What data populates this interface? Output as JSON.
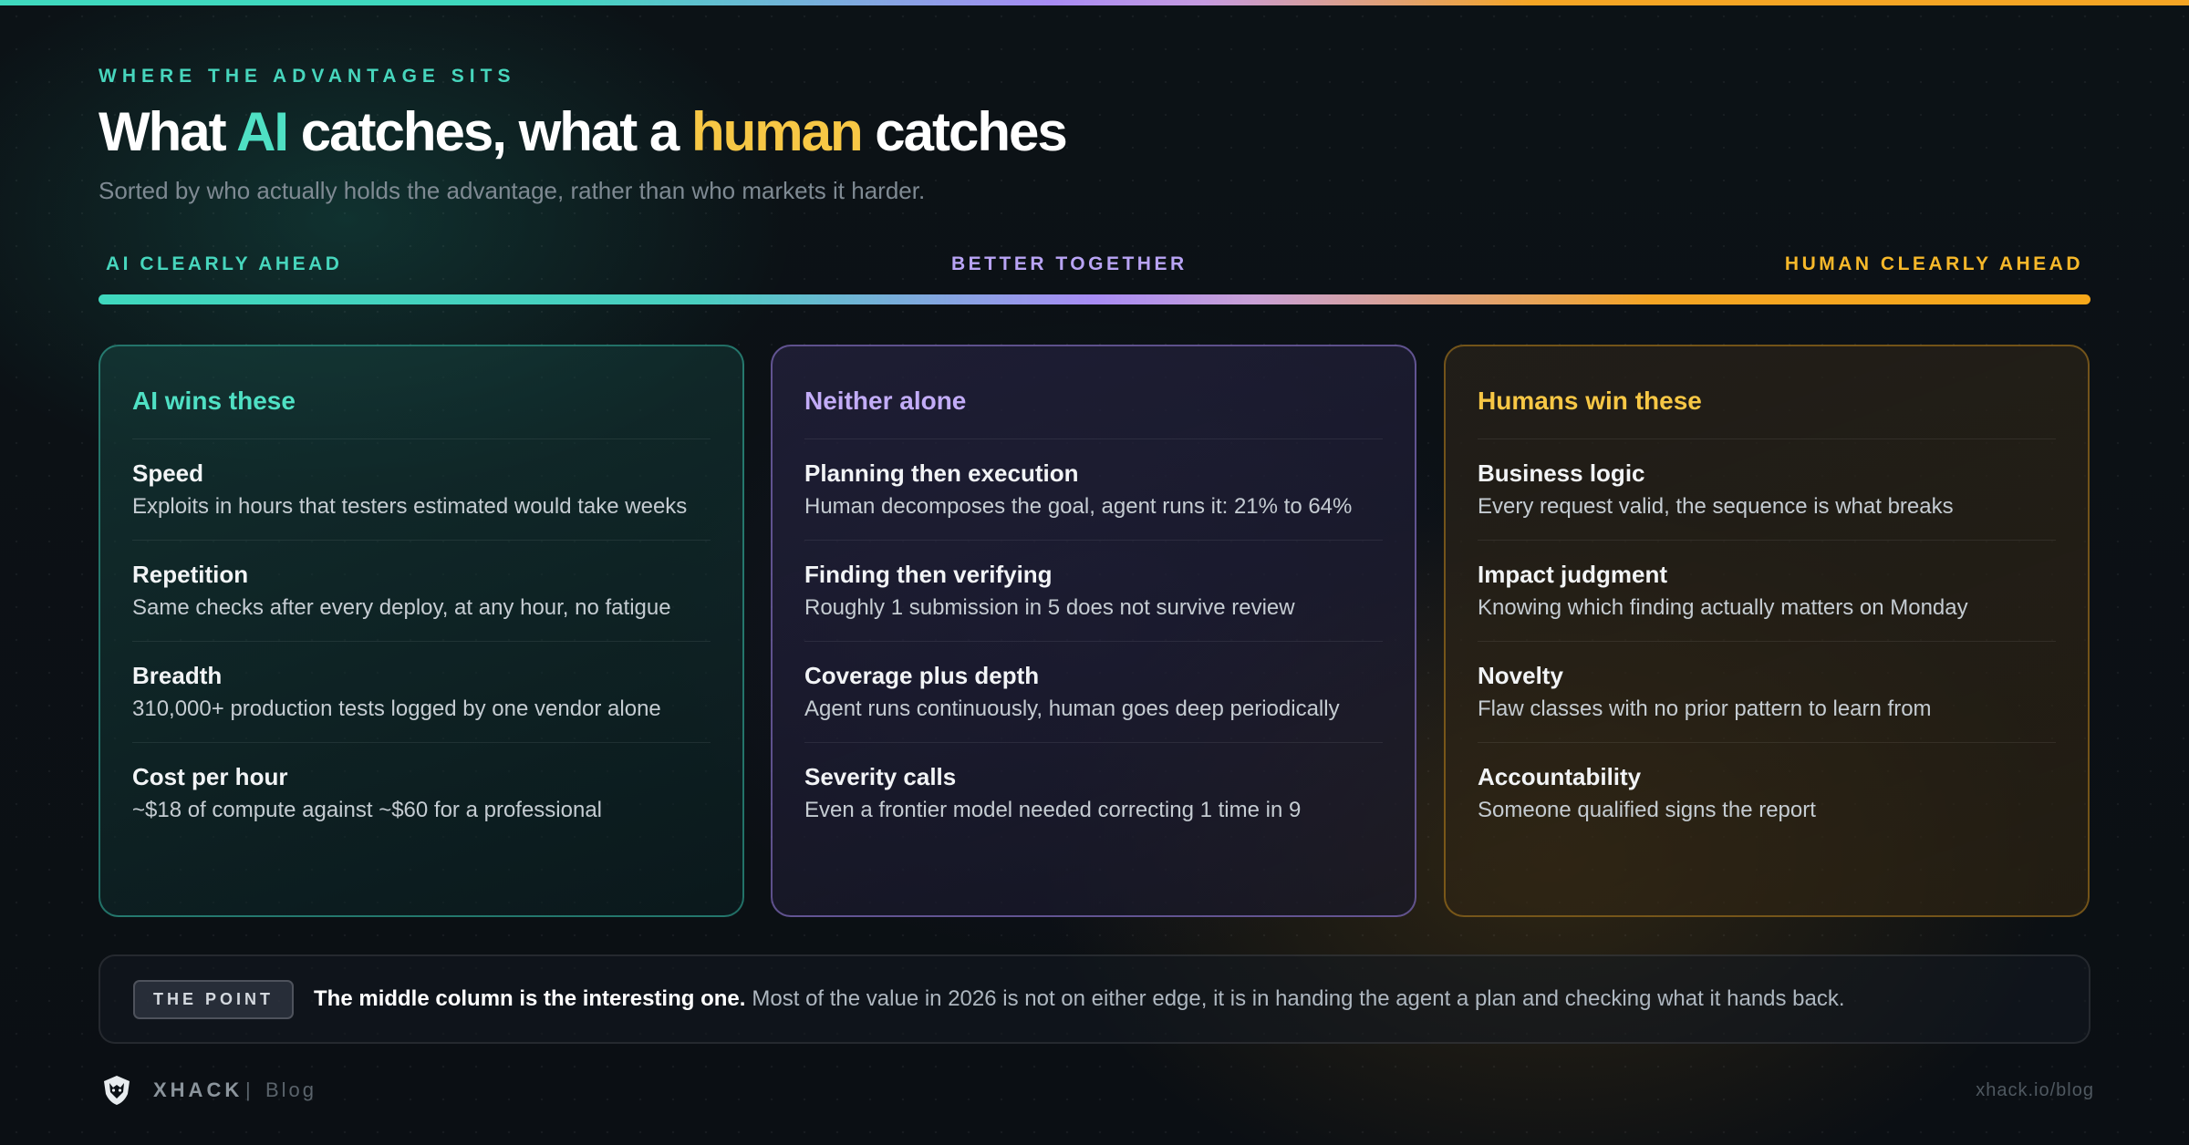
{
  "header": {
    "eyebrow": "WHERE THE ADVANTAGE SITS",
    "title_part1": "What ",
    "title_ai": "AI",
    "title_part2": " catches, what a ",
    "title_human": "human",
    "title_part3": " catches",
    "subtitle": "Sorted by who actually holds the advantage, rather than who markets it harder."
  },
  "scale": {
    "left": "AI CLEARLY AHEAD",
    "middle": "BETTER TOGETHER",
    "right": "HUMAN CLEARLY AHEAD"
  },
  "columns": [
    {
      "title": "AI wins these",
      "accent": "#4fe0c4",
      "items": [
        {
          "title": "Speed",
          "desc": "Exploits in hours that testers estimated would take weeks"
        },
        {
          "title": "Repetition",
          "desc": "Same checks after every deploy, at any hour, no fatigue"
        },
        {
          "title": "Breadth",
          "desc": "310,000+ production tests logged by one vendor alone"
        },
        {
          "title": "Cost per hour",
          "desc": "~$18 of compute against ~$60 for a professional"
        }
      ]
    },
    {
      "title": "Neither alone",
      "accent": "#c2acf7",
      "items": [
        {
          "title": "Planning then execution",
          "desc": "Human decomposes the goal, agent runs it: 21% to 64%"
        },
        {
          "title": "Finding then verifying",
          "desc": "Roughly 1 submission in 5 does not survive review"
        },
        {
          "title": "Coverage plus depth",
          "desc": "Agent runs continuously, human goes deep periodically"
        },
        {
          "title": "Severity calls",
          "desc": "Even a frontier model needed correcting 1 time in 9"
        }
      ]
    },
    {
      "title": "Humans win these",
      "accent": "#f7c745",
      "items": [
        {
          "title": "Business logic",
          "desc": "Every request valid, the sequence is what breaks"
        },
        {
          "title": "Impact judgment",
          "desc": "Knowing which finding actually matters on Monday"
        },
        {
          "title": "Novelty",
          "desc": "Flaw classes with no prior pattern to learn from"
        },
        {
          "title": "Accountability",
          "desc": "Someone qualified signs the report"
        }
      ]
    }
  ],
  "point": {
    "badge": "THE POINT",
    "strong": "The middle column is the interesting one.",
    "text": "Most of the value in 2026 is not on either edge, it is in handing the agent a plan and checking what it hands back."
  },
  "footer": {
    "logo_icon": "wolf-shield-icon",
    "brand": "XHACK",
    "separator": "|",
    "section": "Blog",
    "url": "xhack.io/blog"
  }
}
